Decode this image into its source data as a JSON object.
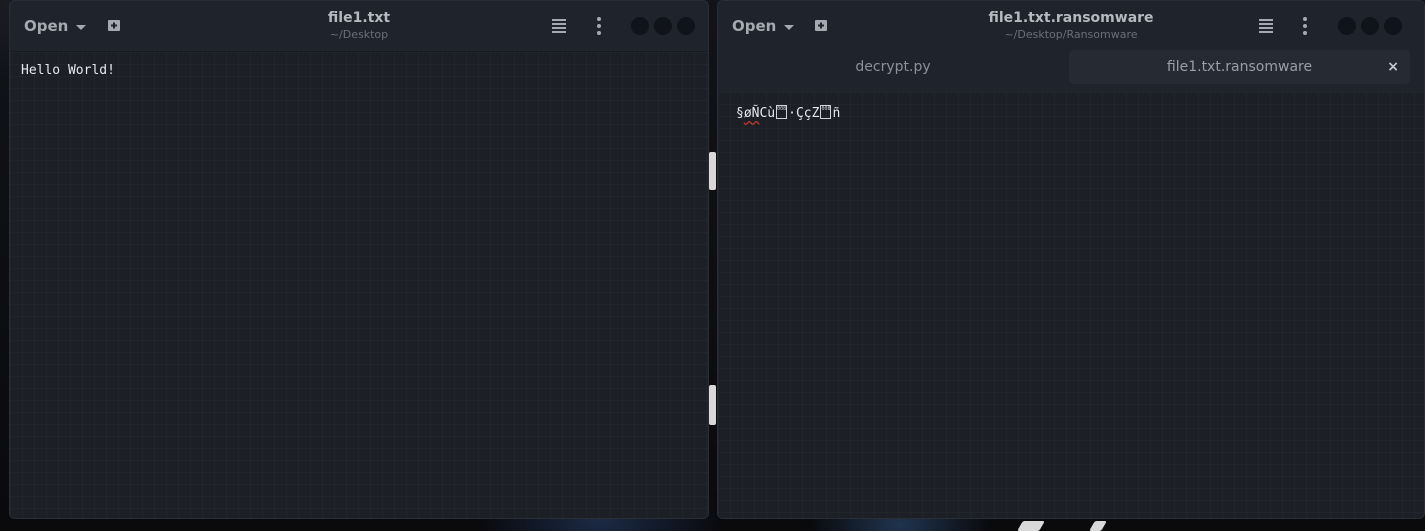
{
  "left_window": {
    "open_label": "Open",
    "title": "file1.txt",
    "subtitle": "~/Desktop",
    "content": "Hello World!"
  },
  "right_window": {
    "open_label": "Open",
    "title": "file1.txt.ransomware",
    "subtitle": "~/Desktop/Ransomware",
    "tabs": [
      {
        "label": "decrypt.py",
        "active": false
      },
      {
        "label": "file1.txt.ransomware",
        "active": true
      }
    ],
    "tab_close": "×",
    "content": {
      "part1": "§",
      "part2_underlined": "øÑ",
      "part3": "Cù",
      "box1_code": "0084",
      "part4": "·ÇçZ",
      "box2_code": "0081",
      "part5": "ñ"
    }
  },
  "colors": {
    "window_bg": "#1c1f26",
    "headerbar_bg": "#1f232b",
    "text": "#e6e8ec",
    "spellcheck": "#c0392b"
  },
  "icons": [
    "new-tab-icon",
    "hamburger-menu-icon",
    "kebab-menu-icon",
    "caret-down-icon",
    "close-icon"
  ]
}
